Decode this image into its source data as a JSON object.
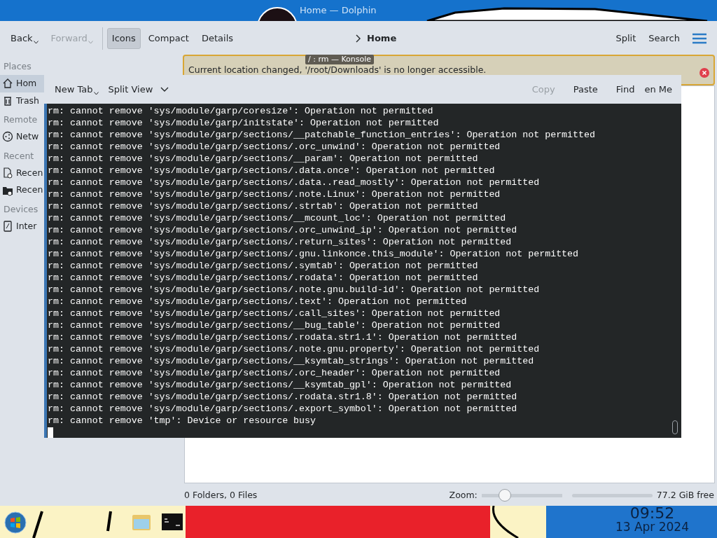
{
  "dolphin": {
    "title": "Home — Dolphin",
    "toolbar": {
      "nav": [
        {
          "label": "Back",
          "disabled": false
        },
        {
          "label": "Forward",
          "disabled": true
        }
      ],
      "views": [
        {
          "label": "Icons",
          "selected": true
        },
        {
          "label": "Compact",
          "selected": false
        },
        {
          "label": "Details",
          "selected": false
        }
      ],
      "breadcrumb": "Home",
      "right": [
        "Split",
        "Search"
      ]
    },
    "sidebar": [
      {
        "heading": "Places",
        "items": [
          {
            "label": "Hom",
            "kind": "home",
            "selected": true
          },
          {
            "label": "Trash",
            "kind": "trash",
            "selected": false
          }
        ]
      },
      {
        "heading": "Remote",
        "items": [
          {
            "label": "Netw",
            "kind": "network",
            "selected": false
          }
        ]
      },
      {
        "heading": "Recent",
        "items": [
          {
            "label": "Recen",
            "kind": "file",
            "selected": false
          },
          {
            "label": "Recen",
            "kind": "folder",
            "selected": false
          }
        ]
      },
      {
        "heading": "Devices",
        "items": [
          {
            "label": "Inter",
            "kind": "drive",
            "selected": false
          }
        ]
      }
    ],
    "notice": "Current location changed, '/root/Downloads' is no longer accessible.",
    "status": {
      "summary": "0 Folders, 0 Files",
      "zoom_label": "Zoom:",
      "zoom": {
        "level": 0.29
      },
      "free": "77.2 GiB free"
    }
  },
  "konsole": {
    "title": "/ : rm — Konsole",
    "toolbar": {
      "left": [
        {
          "label": "New Tab",
          "caret": true
        },
        {
          "label": "Split View",
          "caret": false
        }
      ],
      "right": [
        {
          "label": "Copy",
          "disabled": true
        },
        {
          "label": "Paste",
          "disabled": false
        },
        {
          "label": "Find",
          "disabled": false
        },
        {
          "label": "en Me",
          "disabled": false
        }
      ]
    },
    "lines": [
      "rm: cannot remove 'sys/module/garp/coresize': Operation not permitted",
      "rm: cannot remove 'sys/module/garp/initstate': Operation not permitted",
      "rm: cannot remove 'sys/module/garp/sections/__patchable_function_entries': Operation not permitted",
      "rm: cannot remove 'sys/module/garp/sections/.orc_unwind': Operation not permitted",
      "rm: cannot remove 'sys/module/garp/sections/__param': Operation not permitted",
      "rm: cannot remove 'sys/module/garp/sections/.data.once': Operation not permitted",
      "rm: cannot remove 'sys/module/garp/sections/.data..read_mostly': Operation not permitted",
      "rm: cannot remove 'sys/module/garp/sections/.note.Linux': Operation not permitted",
      "rm: cannot remove 'sys/module/garp/sections/.strtab': Operation not permitted",
      "rm: cannot remove 'sys/module/garp/sections/__mcount_loc': Operation not permitted",
      "rm: cannot remove 'sys/module/garp/sections/.orc_unwind_ip': Operation not permitted",
      "rm: cannot remove 'sys/module/garp/sections/.return_sites': Operation not permitted",
      "rm: cannot remove 'sys/module/garp/sections/.gnu.linkonce.this_module': Operation not permitted",
      "rm: cannot remove 'sys/module/garp/sections/.symtab': Operation not permitted",
      "rm: cannot remove 'sys/module/garp/sections/.rodata': Operation not permitted",
      "rm: cannot remove 'sys/module/garp/sections/.note.gnu.build-id': Operation not permitted",
      "rm: cannot remove 'sys/module/garp/sections/.text': Operation not permitted",
      "rm: cannot remove 'sys/module/garp/sections/.call_sites': Operation not permitted",
      "rm: cannot remove 'sys/module/garp/sections/__bug_table': Operation not permitted",
      "rm: cannot remove 'sys/module/garp/sections/.rodata.str1.1': Operation not permitted",
      "rm: cannot remove 'sys/module/garp/sections/.note.gnu.property': Operation not permitted",
      "rm: cannot remove 'sys/module/garp/sections/__ksymtab_strings': Operation not permitted",
      "rm: cannot remove 'sys/module/garp/sections/.orc_header': Operation not permitted",
      "rm: cannot remove 'sys/module/garp/sections/__ksymtab_gpl': Operation not permitted",
      "rm: cannot remove 'sys/module/garp/sections/.rodata.str1.8': Operation not permitted",
      "rm: cannot remove 'sys/module/garp/sections/.export_symbol': Operation not permitted",
      "rm: cannot remove 'tmp': Device or resource busy"
    ]
  },
  "taskbar": {
    "time": "09:52",
    "date": "13 Apr 2024"
  }
}
